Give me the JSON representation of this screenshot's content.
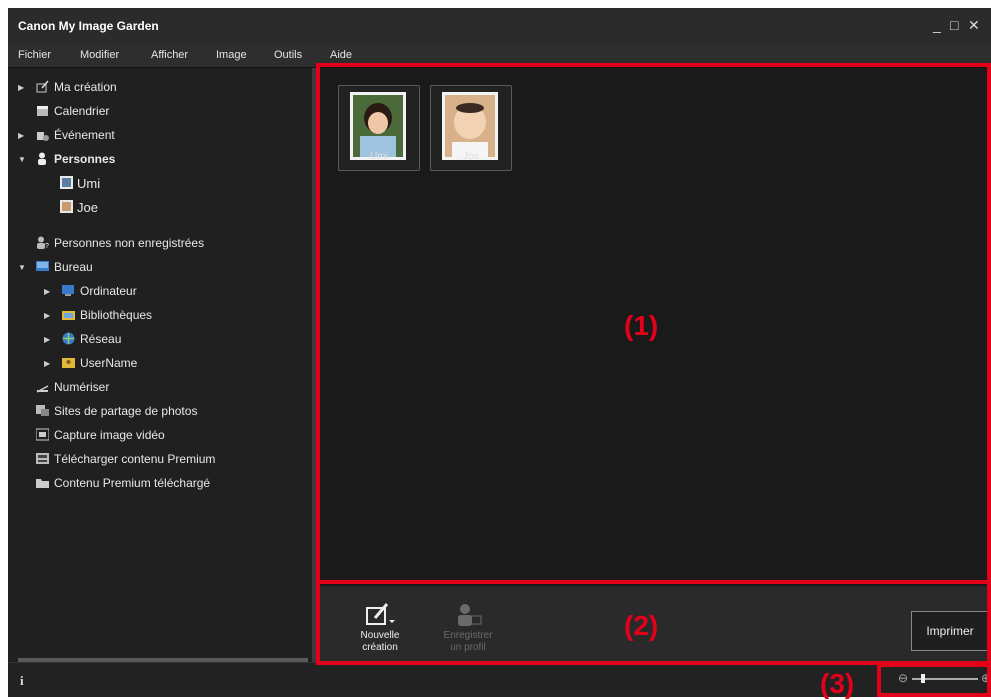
{
  "window": {
    "title": "Canon My Image Garden",
    "controls": {
      "minimize": "_",
      "maximize": "□",
      "close": "✕"
    }
  },
  "menu": [
    "Fichier",
    "Modifier",
    "Afficher",
    "Image",
    "Outils",
    "Aide"
  ],
  "sidebar": {
    "items": [
      {
        "label": "Ma création",
        "icon": "pencil-frame-icon",
        "arrow": "▶"
      },
      {
        "label": "Calendrier",
        "icon": "calendar-icon",
        "arrow": ""
      },
      {
        "label": "Événement",
        "icon": "event-icon",
        "arrow": "▶"
      },
      {
        "label": "Personnes",
        "icon": "person-icon",
        "arrow": "▼"
      },
      {
        "label": "Umi",
        "icon": "face-icon",
        "arrow": ""
      },
      {
        "label": "Joe",
        "icon": "face-icon",
        "arrow": ""
      },
      {
        "label": "Personnes non enregistrées",
        "icon": "unknown-person-icon",
        "arrow": ""
      },
      {
        "label": "Bureau",
        "icon": "desktop-icon",
        "arrow": "▼"
      },
      {
        "label": "Ordinateur",
        "icon": "computer-icon",
        "arrow": "▶"
      },
      {
        "label": "Bibliothèques",
        "icon": "library-icon",
        "arrow": "▶"
      },
      {
        "label": "Réseau",
        "icon": "network-icon",
        "arrow": "▶"
      },
      {
        "label": "UserName",
        "icon": "user-folder-icon",
        "arrow": "▶"
      },
      {
        "label": "Numériser",
        "icon": "scan-icon",
        "arrow": ""
      },
      {
        "label": "Sites de partage de photos",
        "icon": "photo-share-icon",
        "arrow": ""
      },
      {
        "label": "Capture image vidéo",
        "icon": "video-capture-icon",
        "arrow": ""
      },
      {
        "label": "Télécharger contenu Premium",
        "icon": "download-premium-icon",
        "arrow": ""
      },
      {
        "label": "Contenu Premium téléchargé",
        "icon": "folder-icon",
        "arrow": ""
      }
    ]
  },
  "people": [
    {
      "name": "Umi"
    },
    {
      "name": "Joe"
    }
  ],
  "toolbar": {
    "new_creation": "Nouvelle création",
    "register_profile": "Enregistrer un profil",
    "print": "Imprimer"
  },
  "status": {
    "info_icon": "i"
  },
  "zoom": {
    "minus": "⊖",
    "plus": "⊕",
    "level": 0.15
  },
  "callouts": [
    "(1)",
    "(2)",
    "(3)"
  ],
  "colors": {
    "callout": "#e3001b",
    "bg": "#1a1a1a"
  }
}
